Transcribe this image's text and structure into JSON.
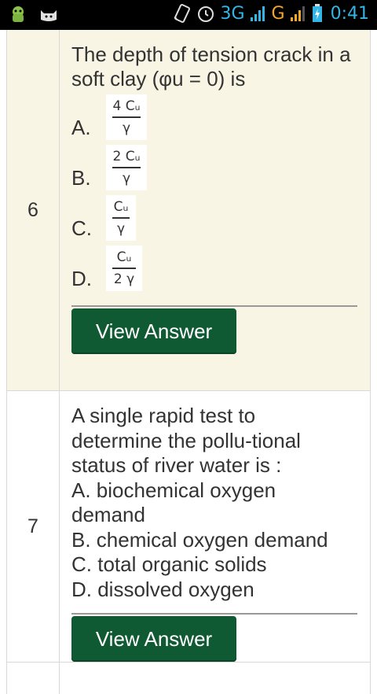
{
  "statusbar": {
    "network": "3G",
    "network2": "G",
    "time": "0:41"
  },
  "questions": [
    {
      "number": "6",
      "text": "The depth of tension crack in a soft clay (φu = 0) is",
      "options": [
        {
          "label": "A.",
          "numerator": "4 Cᵤ",
          "denominator": "γ"
        },
        {
          "label": "B.",
          "numerator": "2 Cᵤ",
          "denominator": "γ"
        },
        {
          "label": "C.",
          "numerator": "Cᵤ",
          "denominator": "γ"
        },
        {
          "label": "D.",
          "numerator": "Cᵤ",
          "denominator": "2 γ"
        }
      ],
      "button": "View Answer"
    },
    {
      "number": "7",
      "lines": [
        "A single rapid test to",
        "determine the pollu-tional",
        "status of river water is :",
        "A. biochemical oxygen",
        "demand",
        "B. chemical oxygen demand",
        "C. total organic solids",
        "D. dissolved oxygen"
      ],
      "button": "View Answer"
    }
  ]
}
